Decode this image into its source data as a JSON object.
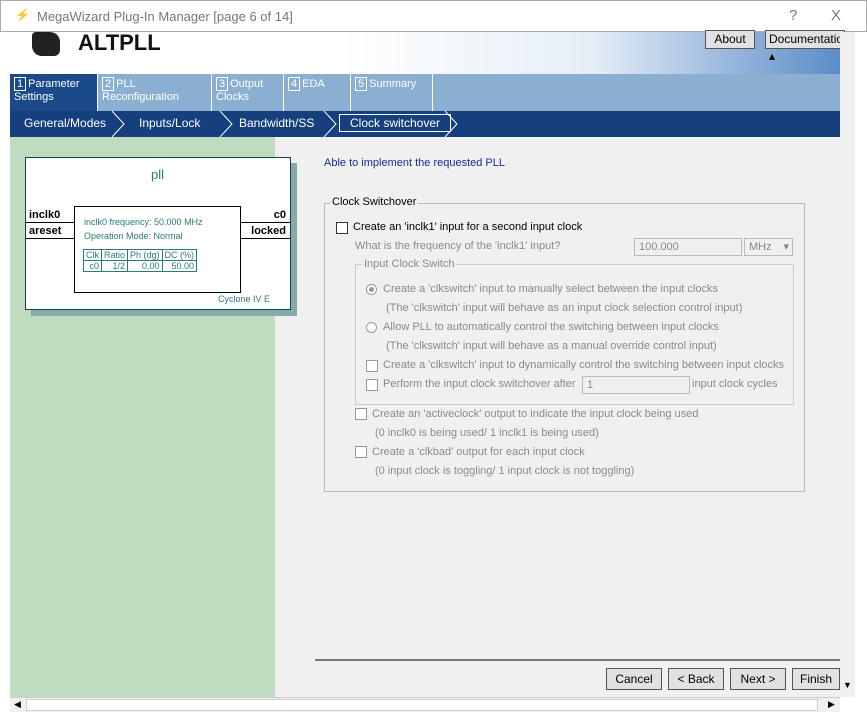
{
  "window": {
    "title": "MegaWizard Plug-In Manager [page 6 of 14]",
    "help": "?",
    "close": "X"
  },
  "banner": {
    "product": "ALTPLL",
    "about": "About",
    "documentation": "Documentation"
  },
  "tabs": [
    {
      "num": "1",
      "label": "Parameter Settings"
    },
    {
      "num": "2",
      "label": "PLL Reconfiguration"
    },
    {
      "num": "3",
      "label": "Output Clocks"
    },
    {
      "num": "4",
      "label": "EDA"
    },
    {
      "num": "5",
      "label": "Summary"
    }
  ],
  "steps": [
    "General/Modes",
    "Inputs/Lock",
    "Bandwidth/SS",
    "Clock switchover"
  ],
  "diagram": {
    "name": "pll",
    "inputs": [
      "inclk0",
      "areset"
    ],
    "outputs": [
      "c0",
      "locked"
    ],
    "freq": "inclk0 frequency: 50.000 MHz",
    "mode": "Operation Mode: Normal",
    "table_headers": [
      "Clk",
      "Ratio",
      "Ph (dg)",
      "DC (%)"
    ],
    "table_row": [
      "c0",
      "1/2",
      "0.00",
      "50.00"
    ],
    "device": "Cyclone IV E"
  },
  "status": "Able to implement the requested PLL",
  "group": {
    "title": "Clock Switchover",
    "create_inclk1": "Create an 'inclk1' input for a second input clock",
    "freq_q": "What is the frequency of the 'inclk1' input?",
    "freq_value": "100.000",
    "freq_unit": "MHz",
    "sub_title": "Input Clock Switch",
    "radio1": "Create a 'clkswitch' input to manually select between the input clocks",
    "radio1_note": "(The 'clkswitch' input will behave as an input clock selection control input)",
    "radio2": "Allow PLL to automatically control the switching between input clocks",
    "radio2_note": "(The 'clkswitch' input will behave as a manual override control input)",
    "dyn": "Create a 'clkswitch' input to dynamically control the switching between input clocks",
    "after": "Perform the input clock switchover after",
    "after_value": "1",
    "after_unit": "input clock cycles",
    "activeclock": "Create an 'activeclock' output to indicate the input clock being used",
    "activeclock_note": "(0 inclk0 is being used/ 1 inclk1 is being used)",
    "clkbad": "Create a 'clkbad' output for each input clock",
    "clkbad_note": "(0 input clock is toggling/ 1 input clock is not toggling)"
  },
  "buttons": {
    "cancel": "Cancel",
    "back": "< Back",
    "next": "Next >",
    "finish": "Finish"
  }
}
